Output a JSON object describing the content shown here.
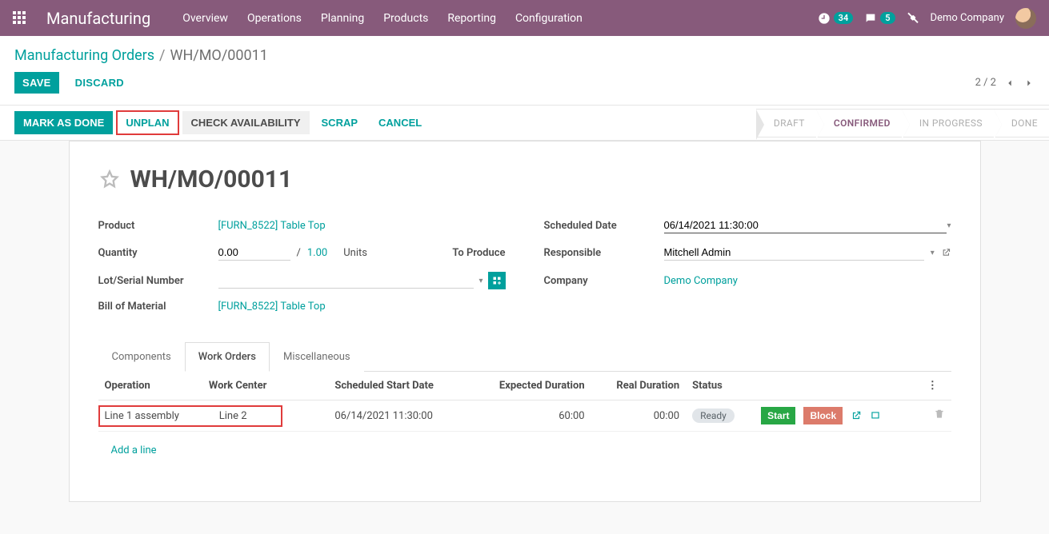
{
  "brand": "Manufacturing",
  "top_menu": [
    "Overview",
    "Operations",
    "Planning",
    "Products",
    "Reporting",
    "Configuration"
  ],
  "top_right": {
    "timer_badge": "34",
    "msg_badge": "5",
    "company": "Demo Company"
  },
  "breadcrumb": {
    "root": "Manufacturing Orders",
    "current": "WH/MO/00011"
  },
  "buttons": {
    "save": "Save",
    "discard": "Discard",
    "mark_done": "Mark as Done",
    "unplan": "Unplan",
    "check_avail": "Check Availability",
    "scrap": "Scrap",
    "cancel": "Cancel"
  },
  "pager": "2 / 2",
  "stages": [
    "Draft",
    "Confirmed",
    "In Progress",
    "Done"
  ],
  "stage_active_index": 1,
  "record": {
    "title": "WH/MO/00011",
    "labels": {
      "product": "Product",
      "quantity": "Quantity",
      "lot": "Lot/Serial Number",
      "bom": "Bill of Material",
      "sched": "Scheduled Date",
      "responsible": "Responsible",
      "company": "Company"
    },
    "product": "[FURN_8522] Table Top",
    "quantity_value": "0.00",
    "quantity_sep": "/",
    "quantity_target": "1.00",
    "quantity_uom": "Units",
    "to_produce": "To Produce",
    "bom": "[FURN_8522] Table Top",
    "scheduled_date": "06/14/2021 11:30:00",
    "responsible": "Mitchell Admin",
    "company": "Demo Company"
  },
  "tabs": [
    "Components",
    "Work Orders",
    "Miscellaneous"
  ],
  "tab_active_index": 1,
  "workorders": {
    "headers": {
      "operation": "Operation",
      "work_center": "Work Center",
      "sched_start": "Scheduled Start Date",
      "exp_dur": "Expected Duration",
      "real_dur": "Real Duration",
      "status": "Status"
    },
    "rows": [
      {
        "operation": "Line 1 assembly",
        "work_center": "Line 2",
        "sched_start": "06/14/2021 11:30:00",
        "exp_dur": "60:00",
        "real_dur": "00:00",
        "status": "Ready"
      }
    ],
    "row_buttons": {
      "start": "Start",
      "block": "Block"
    },
    "add_line": "Add a line"
  }
}
